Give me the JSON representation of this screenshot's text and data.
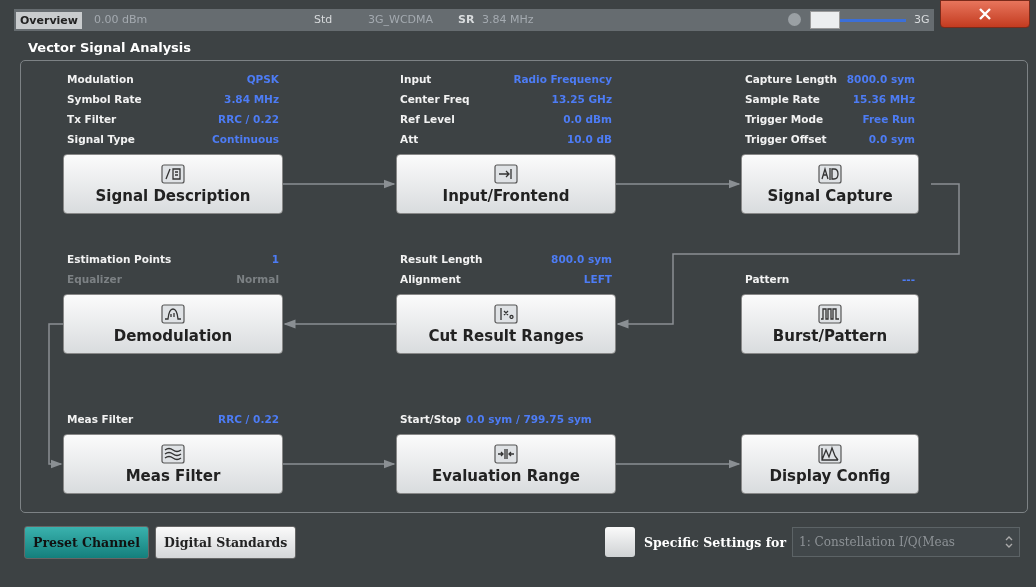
{
  "header": {
    "tab": "Overview",
    "faded_texts": [
      "0.00 dBm",
      "Std",
      "3G_WCDMA",
      "SR",
      "3.84 MHz",
      "3G"
    ]
  },
  "title": "Vector Signal Analysis",
  "blocks": [
    {
      "label": "Signal Description",
      "params": [
        {
          "name": "Modulation",
          "value": "QPSK",
          "disabled": false
        },
        {
          "name": "Symbol Rate",
          "value": "3.84 MHz",
          "disabled": false
        },
        {
          "name": "Tx Filter",
          "value": "RRC / 0.22",
          "disabled": false
        },
        {
          "name": "Signal Type",
          "value": "Continuous",
          "disabled": false
        }
      ]
    },
    {
      "label": "Input/Frontend",
      "params": [
        {
          "name": "Input",
          "value": "Radio Frequency",
          "disabled": false
        },
        {
          "name": "Center Freq",
          "value": "13.25 GHz",
          "disabled": false
        },
        {
          "name": "Ref Level",
          "value": "0.0 dBm",
          "disabled": false
        },
        {
          "name": "Att",
          "value": "10.0 dB",
          "disabled": false
        }
      ]
    },
    {
      "label": "Signal Capture",
      "params": [
        {
          "name": "Capture Length",
          "value": "8000.0 sym",
          "disabled": false
        },
        {
          "name": "Sample Rate",
          "value": "15.36 MHz",
          "disabled": false
        },
        {
          "name": "Trigger Mode",
          "value": "Free Run",
          "disabled": false
        },
        {
          "name": "Trigger Offset",
          "value": "0.0 sym",
          "disabled": false
        }
      ]
    },
    {
      "label": "Demodulation",
      "params": [
        {
          "name": "Estimation Points",
          "value": "1",
          "disabled": false
        },
        {
          "name": "Equalizer",
          "value": "Normal",
          "disabled": true
        }
      ]
    },
    {
      "label": "Cut Result Ranges",
      "params": [
        {
          "name": "Result Length",
          "value": "800.0 sym",
          "disabled": false
        },
        {
          "name": "Alignment",
          "value": "LEFT",
          "disabled": false
        }
      ]
    },
    {
      "label": "Burst/Pattern",
      "params": [
        {
          "name": "Pattern",
          "value": "---",
          "disabled": false
        }
      ]
    },
    {
      "label": "Meas Filter",
      "params": [
        {
          "name": "Meas Filter",
          "value": "RRC / 0.22",
          "disabled": false
        }
      ]
    },
    {
      "label": "Evaluation Range",
      "params": [
        {
          "name": "Start/Stop",
          "value": "0.0 sym / 799.75 sym",
          "disabled": false,
          "inline": true
        }
      ]
    },
    {
      "label": "Display Config"
    }
  ],
  "footer": {
    "buttons": [
      {
        "label": "Preset Channel",
        "selected": true
      },
      {
        "label": "Digital Standards",
        "selected": false
      }
    ],
    "specific_settings": {
      "checked": false,
      "label": "Specific Settings for",
      "value": "1: Constellation I/Q(Meas"
    }
  }
}
